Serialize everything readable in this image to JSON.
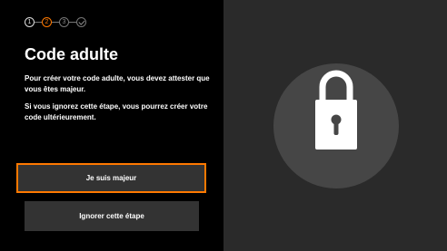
{
  "stepper": {
    "steps": [
      "1",
      "2",
      "3",
      ""
    ],
    "current_step": 2,
    "total_steps": 4
  },
  "title": "Code adulte",
  "paragraphs": [
    "Pour créer votre code adulte, vous devez attester que vous êtes majeur.",
    "Si vous ignorez cette étape, vous pourrez créer votre code ultérieurement."
  ],
  "buttons": {
    "confirm_label": "Je suis majeur",
    "skip_label": "Ignorer cette étape"
  },
  "colors": {
    "accent": "#ff7900",
    "background": "#000000",
    "right_panel": "#2a2a2a",
    "button": "#333333"
  },
  "icons": {
    "illustration": "lock-icon"
  }
}
